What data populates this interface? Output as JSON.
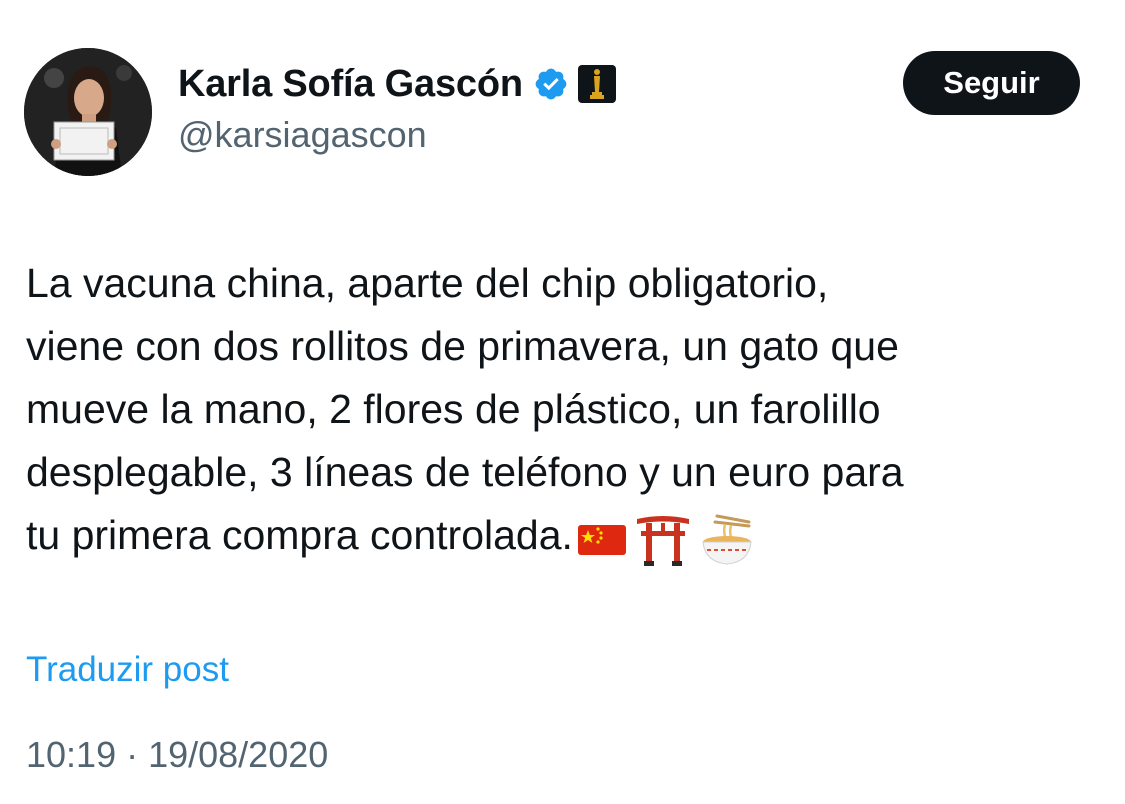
{
  "author": {
    "display_name": "Karla Sofía Gascón",
    "handle": "@karsiagascon"
  },
  "follow_button": {
    "label": "Seguir"
  },
  "post": {
    "lines": [
      "La vacuna china, aparte del chip obligatorio,",
      "viene con dos rollitos de primavera, un gato que",
      "mueve la mano, 2 flores de plástico, un farolillo",
      "desplegable, 3 líneas de teléfono y un euro para",
      "tu primera compra controlada."
    ],
    "emojis": [
      "china-flag-icon",
      "torii-gate-icon",
      "noodle-bowl-icon"
    ]
  },
  "translate_link": {
    "label": "Traduzir post"
  },
  "timestamp": {
    "text": "10:19 · 19/08/2020"
  },
  "colors": {
    "link": "#1d9bf0",
    "verified": "#1d9bf0",
    "secondary_text": "#536471",
    "button_bg": "#0f1419"
  }
}
